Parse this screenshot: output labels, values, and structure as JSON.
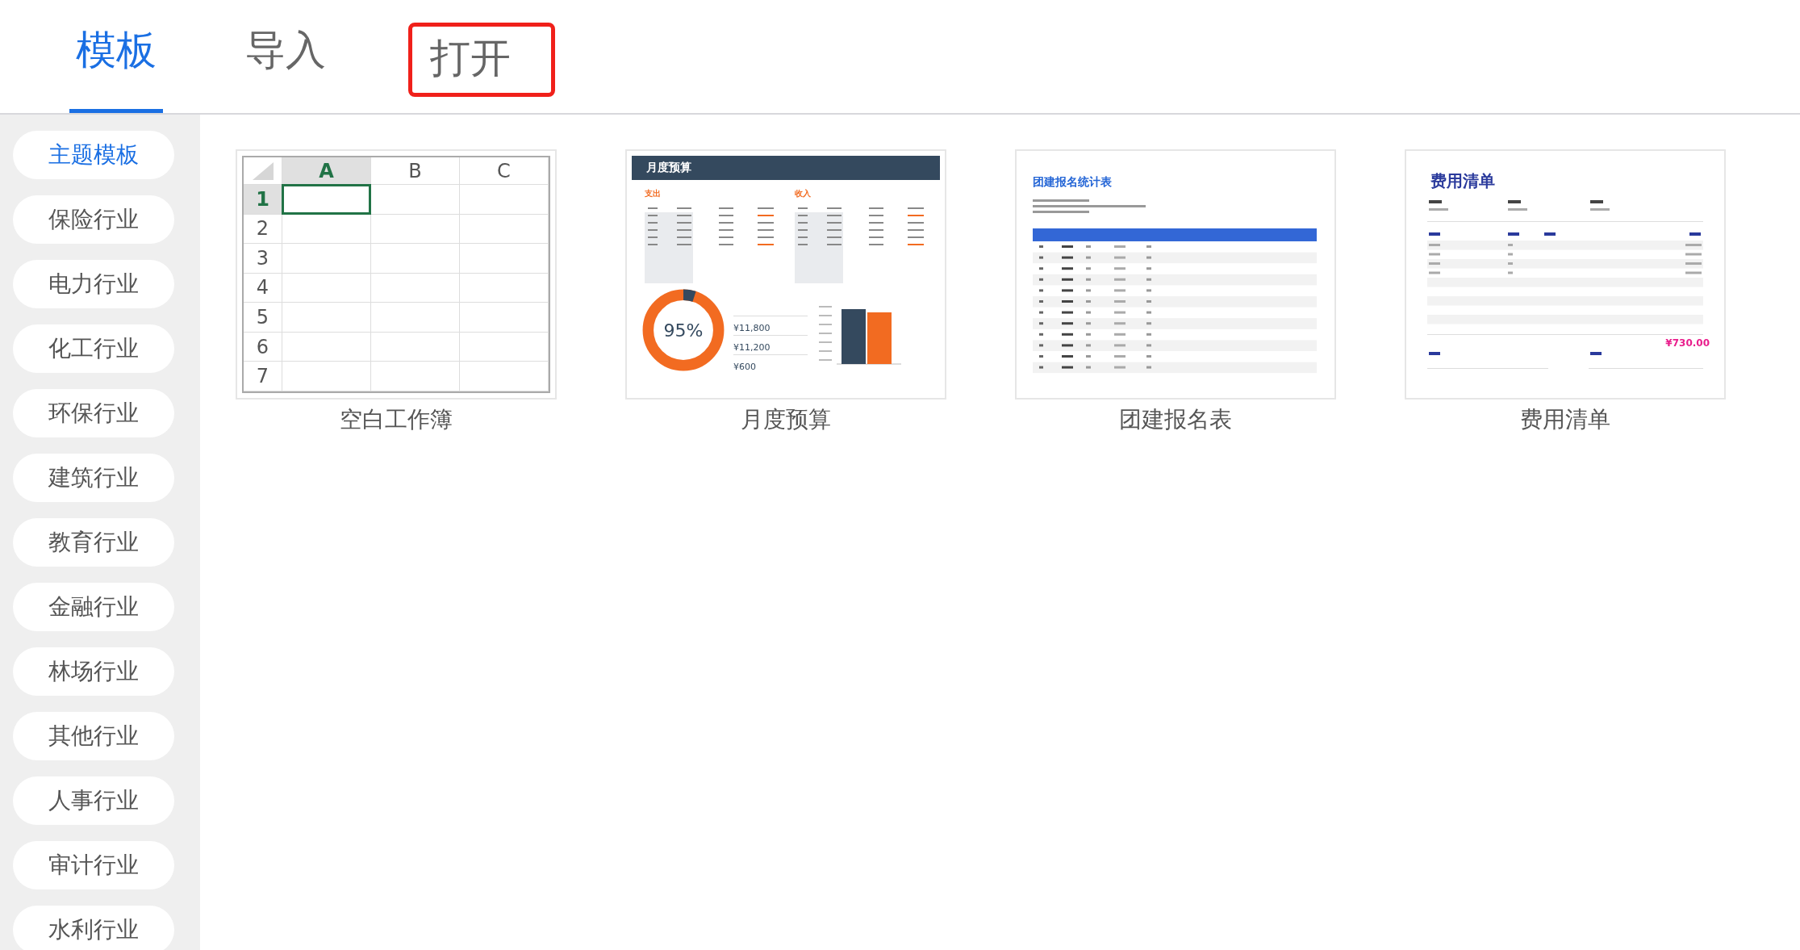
{
  "tabs": [
    {
      "label": "模板",
      "selected": true,
      "highlighted": false
    },
    {
      "label": "导入",
      "selected": false,
      "highlighted": false
    },
    {
      "label": "打开",
      "selected": false,
      "highlighted": true
    }
  ],
  "sidebar": {
    "items": [
      {
        "label": "主题模板",
        "selected": true
      },
      {
        "label": "保险行业",
        "selected": false
      },
      {
        "label": "电力行业",
        "selected": false
      },
      {
        "label": "化工行业",
        "selected": false
      },
      {
        "label": "环保行业",
        "selected": false
      },
      {
        "label": "建筑行业",
        "selected": false
      },
      {
        "label": "教育行业",
        "selected": false
      },
      {
        "label": "金融行业",
        "selected": false
      },
      {
        "label": "林场行业",
        "selected": false
      },
      {
        "label": "其他行业",
        "selected": false
      },
      {
        "label": "人事行业",
        "selected": false
      },
      {
        "label": "审计行业",
        "selected": false
      },
      {
        "label": "水利行业",
        "selected": false
      }
    ]
  },
  "templates": [
    {
      "kind": "spreadsheet",
      "caption": "空白工作簿",
      "columns": [
        "A",
        "B",
        "C"
      ],
      "rows": [
        "1",
        "2",
        "3",
        "4",
        "5",
        "6",
        "7"
      ]
    },
    {
      "kind": "budget",
      "caption": "月度预算",
      "title": "月度预算",
      "sections": [
        "支出",
        "收入"
      ],
      "percent": "95%",
      "amounts": [
        "¥11,800",
        "¥11,200",
        "¥600"
      ]
    },
    {
      "kind": "roster",
      "caption": "团建报名表",
      "title": "团建报名统计表"
    },
    {
      "kind": "expense",
      "caption": "费用清单",
      "title": "费用清单",
      "total": "¥730.00"
    }
  ]
}
